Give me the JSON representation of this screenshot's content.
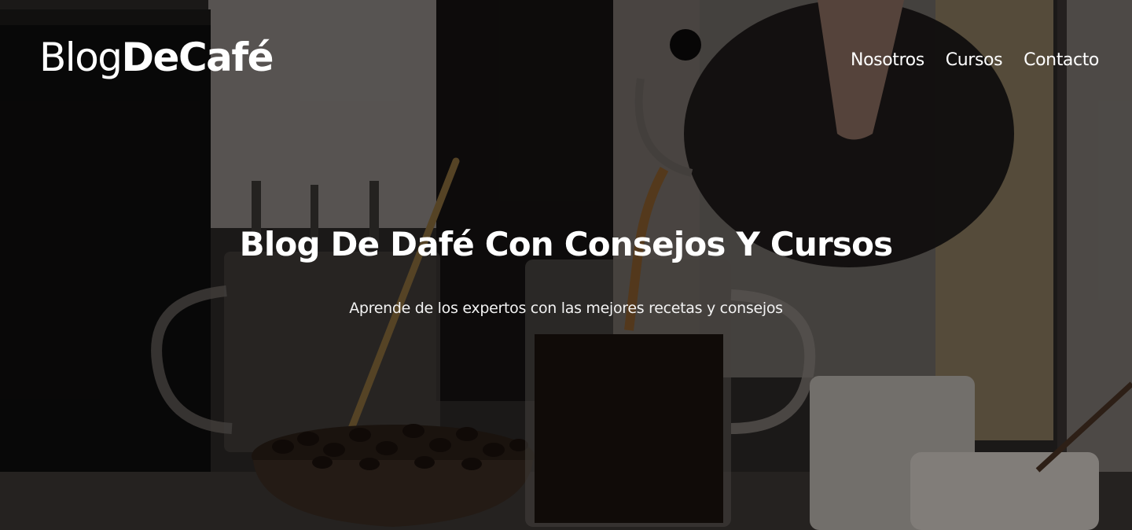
{
  "header": {
    "logo_light": "Blog",
    "logo_bold": "DeCafé",
    "nav": [
      {
        "label": "Nosotros"
      },
      {
        "label": "Cursos"
      },
      {
        "label": "Contacto"
      }
    ]
  },
  "hero": {
    "title": "Blog De Dafé Con Consejos Y Cursos",
    "subtitle": "Aprende de los expertos con las mejores recetas y consejos"
  },
  "background": {
    "description_icon": "coffee-pour-photo-icon",
    "overlay_color": "#000000"
  }
}
